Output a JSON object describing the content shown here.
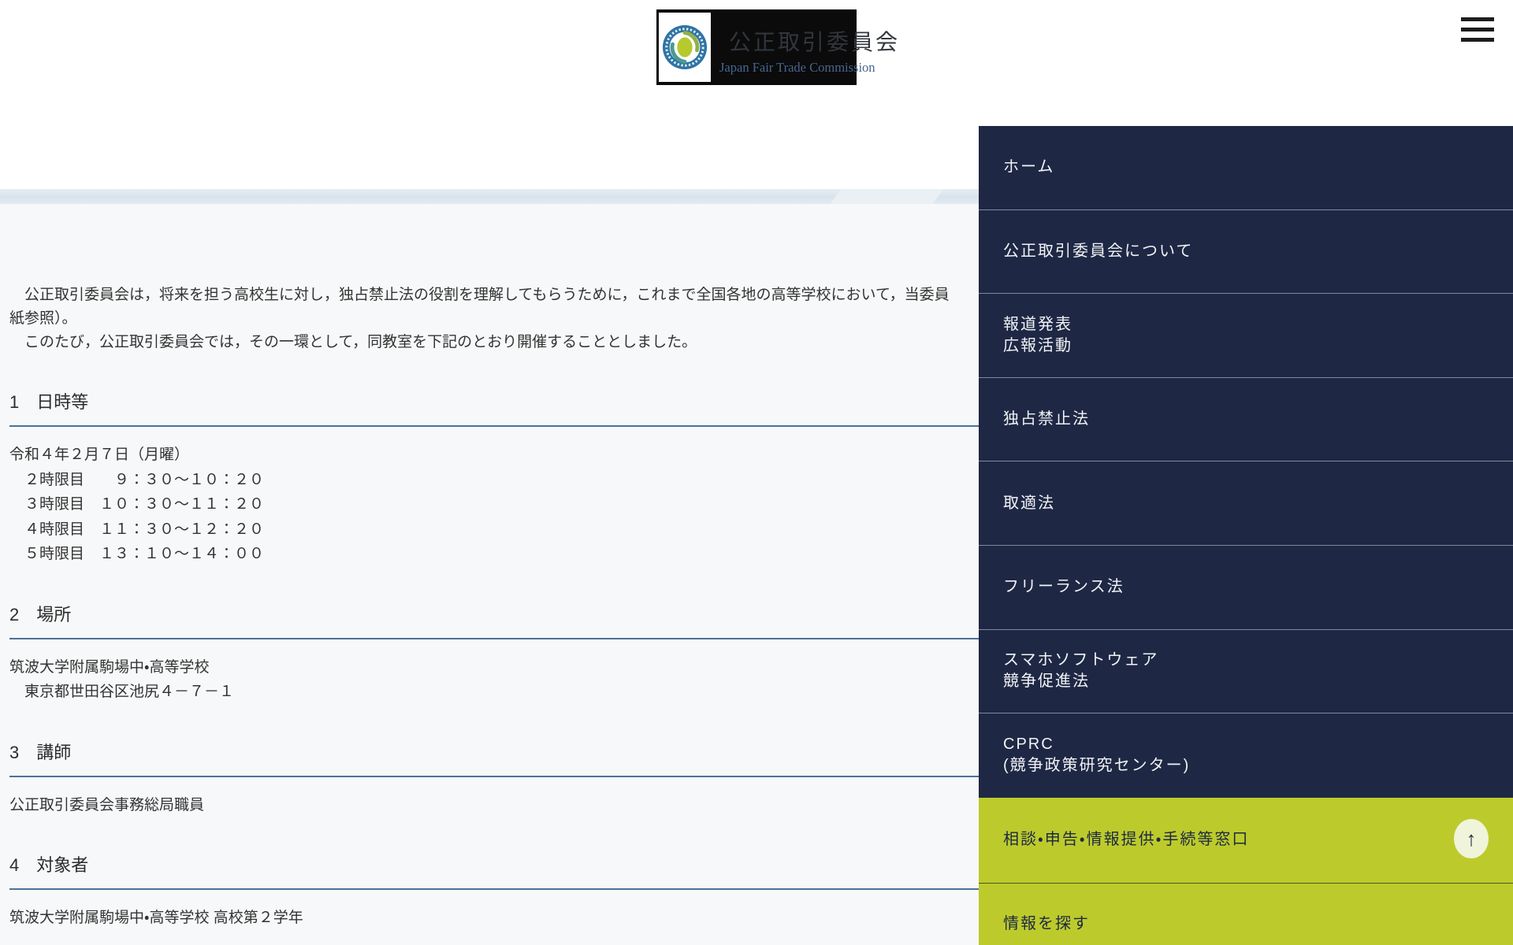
{
  "header": {
    "logo": {
      "jp_title": "公正取引委員会",
      "en_title": "Japan Fair Trade Commission",
      "emblem": "jftc-circular-emblem"
    },
    "menu_icon": "hamburger-icon"
  },
  "content": {
    "intro_lines": [
      "　公正取引委員会は，将来を担う高校生に対し，独占禁止法の役割を理解してもらうために，これまで全国各地の高等学校において，当委員",
      "紙参照）。",
      "　このたび，公正取引委員会では，その一環として，同教室を下記のとおり開催することとしました。"
    ],
    "sections": [
      {
        "heading": "1　日時等",
        "lines": [
          "令和４年２月７日（月曜）",
          "　２時限目　　９：３０～１０：２０",
          "　３時限目　１０：３０～１１：２０",
          "　４時限目　１１：３０～１２：２０",
          "　５時限目　１３：１０～１４：００"
        ]
      },
      {
        "heading": "2　場所",
        "lines": [
          "筑波大学附属駒場中・高等学校",
          "　東京都世田谷区池尻４－７－１"
        ]
      },
      {
        "heading": "3　講師",
        "lines": [
          "公正取引委員会事務総局職員"
        ]
      },
      {
        "heading": "4　対象者",
        "lines": [
          "筑波大学附属駒場中・高等学校 高校第２学年"
        ]
      }
    ]
  },
  "menu": {
    "items": [
      {
        "type": "navy",
        "lines": [
          "ホーム"
        ]
      },
      {
        "type": "navy",
        "lines": [
          "公正取引委員会について"
        ]
      },
      {
        "type": "navy",
        "lines": [
          "報道発表",
          "広報活動"
        ]
      },
      {
        "type": "navy",
        "lines": [
          "独占禁止法"
        ]
      },
      {
        "type": "navy",
        "lines": [
          "取適法"
        ]
      },
      {
        "type": "navy",
        "lines": [
          "フリーランス法"
        ]
      },
      {
        "type": "navy",
        "lines": [
          "スマホソフトウェア",
          "競争促進法"
        ]
      },
      {
        "type": "navy",
        "lines": [
          "CPRC",
          "(競争政策研究センター)"
        ]
      },
      {
        "type": "accent",
        "lines": [
          "相談・申告・情報提供・手続等窓口"
        ]
      },
      {
        "type": "accent",
        "lines": [
          "情報を探す"
        ]
      }
    ]
  },
  "back_to_top": {
    "icon": "up-arrow-icon",
    "glyph": "↑"
  },
  "colors": {
    "menu_navy": "#1e2845",
    "menu_accent_green": "#bccb2b",
    "section_rule_blue": "#4a7298",
    "band_blue": "#d9e3ec",
    "content_background": "#f7f8f9",
    "logo_background": "#0b0b0b",
    "logo_en_blue": "#47658e",
    "emblem_ring_blue": "#2e74a5",
    "emblem_center_green": "#b6c92f"
  }
}
